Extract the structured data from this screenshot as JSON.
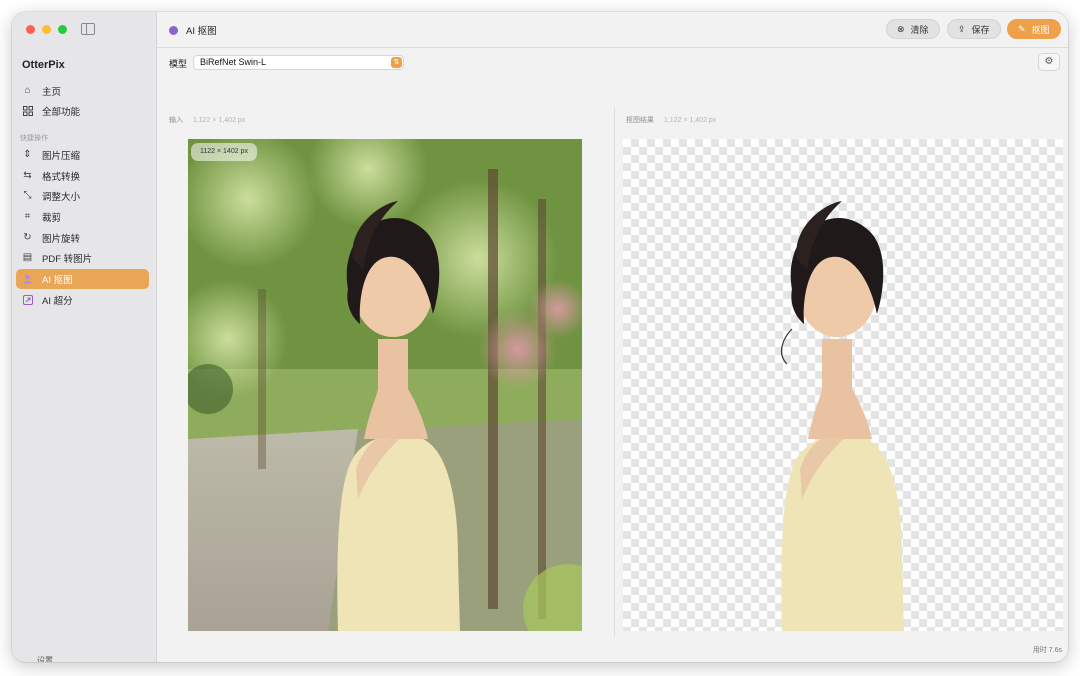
{
  "app": {
    "name": "OtterPix"
  },
  "sidebar": {
    "items": [
      {
        "label": "主页",
        "icon": "home-icon"
      },
      {
        "label": "全部功能",
        "icon": "grid-icon"
      }
    ],
    "section_label": "快捷操作",
    "quick_items": [
      {
        "label": "图片压缩",
        "icon": "compress-icon"
      },
      {
        "label": "格式转换",
        "icon": "convert-icon"
      },
      {
        "label": "调整大小",
        "icon": "resize-icon"
      },
      {
        "label": "裁剪",
        "icon": "crop-icon"
      },
      {
        "label": "图片旋转",
        "icon": "rotate-icon"
      },
      {
        "label": "PDF 转图片",
        "icon": "pdf-icon"
      },
      {
        "label": "AI 抠图",
        "icon": "person-icon",
        "active": true
      },
      {
        "label": "AI 超分",
        "icon": "upscale-icon"
      }
    ],
    "settings_label": "设置"
  },
  "header": {
    "title": "AI 抠图",
    "clear_label": "清除",
    "save_label": "保存",
    "cutout_label": "抠图"
  },
  "model": {
    "label": "模型",
    "selected": "BiRefNet Swin-L"
  },
  "input_pane": {
    "label": "输入",
    "dims": "1,122 × 1,402 px",
    "badge": "1122 × 1402 px"
  },
  "output_pane": {
    "label": "抠图结果",
    "dims": "1,122 × 1,402 px"
  },
  "footer": {
    "elapsed": "用时 7.6s"
  },
  "colors": {
    "accent": "#eea04a",
    "active_nav": "#e9a656"
  }
}
